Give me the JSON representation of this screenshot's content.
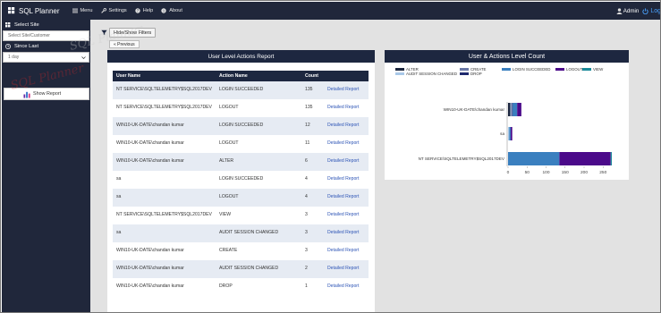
{
  "app": {
    "title": "SQL Planner"
  },
  "nav": [
    {
      "label": "Menu",
      "icon": "hamburger-icon"
    },
    {
      "label": "Settings",
      "icon": "wrench-icon"
    },
    {
      "label": "Help",
      "icon": "help-icon"
    },
    {
      "label": "About",
      "icon": "info-icon"
    }
  ],
  "user": {
    "name": "Admin",
    "logout_label": "Log"
  },
  "sidebar": {
    "select_site_label": "Select Site",
    "site_placeholder": "Select Site/Customer",
    "since_last_label": "Since Last",
    "since_last_value": "1 day",
    "show_report_label": "Show Report"
  },
  "filters": {
    "toggle_label": "Hide/Show Filters",
    "prev_label": "« Previous"
  },
  "report": {
    "title": "User Level Actions Report",
    "columns": [
      "User Name",
      "Action Name",
      "Count"
    ],
    "link_label": "Detailed Report",
    "rows": [
      {
        "user": "NT SERVICE\\SQLTELEMETRY$SQL2017DEV",
        "action": "LOGIN SUCCEEDED",
        "count": "135"
      },
      {
        "user": "NT SERVICE\\SQLTELEMETRY$SQL2017DEV",
        "action": "LOGOUT",
        "count": "135"
      },
      {
        "user": "WIN10-UK-DATE\\chandan kumar",
        "action": "LOGIN SUCCEEDED",
        "count": "12"
      },
      {
        "user": "WIN10-UK-DATE\\chandan kumar",
        "action": "LOGOUT",
        "count": "11"
      },
      {
        "user": "WIN10-UK-DATE\\chandan kumar",
        "action": "ALTER",
        "count": "6"
      },
      {
        "user": "sa",
        "action": "LOGIN SUCCEEDED",
        "count": "4"
      },
      {
        "user": "sa",
        "action": "LOGOUT",
        "count": "4"
      },
      {
        "user": "NT SERVICE\\SQLTELEMETRY$SQL2017DEV",
        "action": "VIEW",
        "count": "3"
      },
      {
        "user": "sa",
        "action": "AUDIT SESSION CHANGED",
        "count": "3"
      },
      {
        "user": "WIN10-UK-DATE\\chandan kumar",
        "action": "CREATE",
        "count": "3"
      },
      {
        "user": "WIN10-UK-DATE\\chandan kumar",
        "action": "AUDIT SESSION CHANGED",
        "count": "2"
      },
      {
        "user": "WIN10-UK-DATE\\chandan kumar",
        "action": "DROP",
        "count": "1"
      }
    ]
  },
  "chart_panel": {
    "title": "User & Actions Level Count"
  },
  "chart_data": {
    "type": "bar",
    "orientation": "horizontal",
    "stacked": true,
    "categories": [
      "WIN10-UK-DATE\\chandan kumar",
      "sa",
      "NT SERVICE\\SQLTELEMETRY$SQL2017DEV"
    ],
    "series": [
      {
        "name": "ALTER",
        "color": "#1d2740",
        "values": [
          6,
          0,
          0
        ]
      },
      {
        "name": "AUDIT SESSION CHANGED",
        "color": "#a9c8e8",
        "values": [
          2,
          3,
          0
        ]
      },
      {
        "name": "CREATE",
        "color": "#6a78a6",
        "values": [
          3,
          0,
          0
        ]
      },
      {
        "name": "DROP",
        "color": "#1f2a6e",
        "values": [
          1,
          0,
          0
        ]
      },
      {
        "name": "LOGIN SUCCEEDED",
        "color": "#3a7fbf",
        "values": [
          12,
          4,
          135
        ]
      },
      {
        "name": "LOGOUT",
        "color": "#4b0a8a",
        "values": [
          11,
          4,
          135
        ]
      },
      {
        "name": "VIEW",
        "color": "#1a8a9a",
        "values": [
          0,
          0,
          3
        ]
      }
    ],
    "xticks": [
      0,
      50,
      100,
      150,
      200,
      250
    ],
    "xlim": [
      0,
      280
    ],
    "legend_position": "top",
    "grid": false
  }
}
